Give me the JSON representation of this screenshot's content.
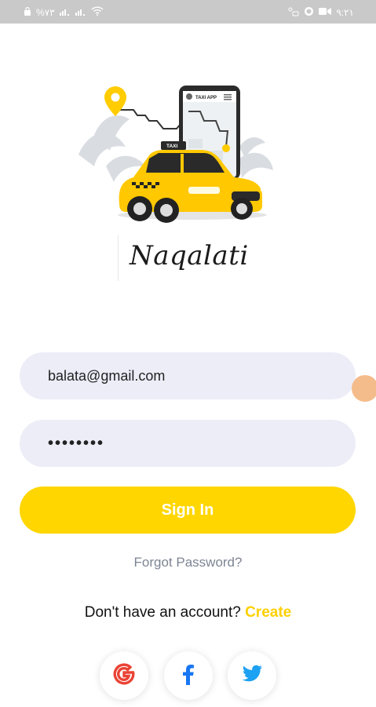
{
  "status_bar": {
    "battery_text": "%٧٣",
    "clock": "٩:٢١"
  },
  "brand": {
    "name": "Naqalati"
  },
  "hero": {
    "phone_label": "TAXI APP",
    "car_sign": "TAXI"
  },
  "form": {
    "email_value": "balata@gmail.com",
    "password_value": "••••••••",
    "sign_in_label": "Sign In",
    "forgot_label": "Forgot Password?",
    "signup_prompt": "Don't have an account?",
    "create_label": "Create"
  },
  "social": [
    "google-icon",
    "facebook-icon",
    "twitter-icon"
  ],
  "colors": {
    "accent": "#ffd600",
    "field_bg": "#ecedf7",
    "muted_text": "#7d8593",
    "google": "#ea4335",
    "facebook": "#1877f2",
    "twitter": "#1da1f2"
  }
}
